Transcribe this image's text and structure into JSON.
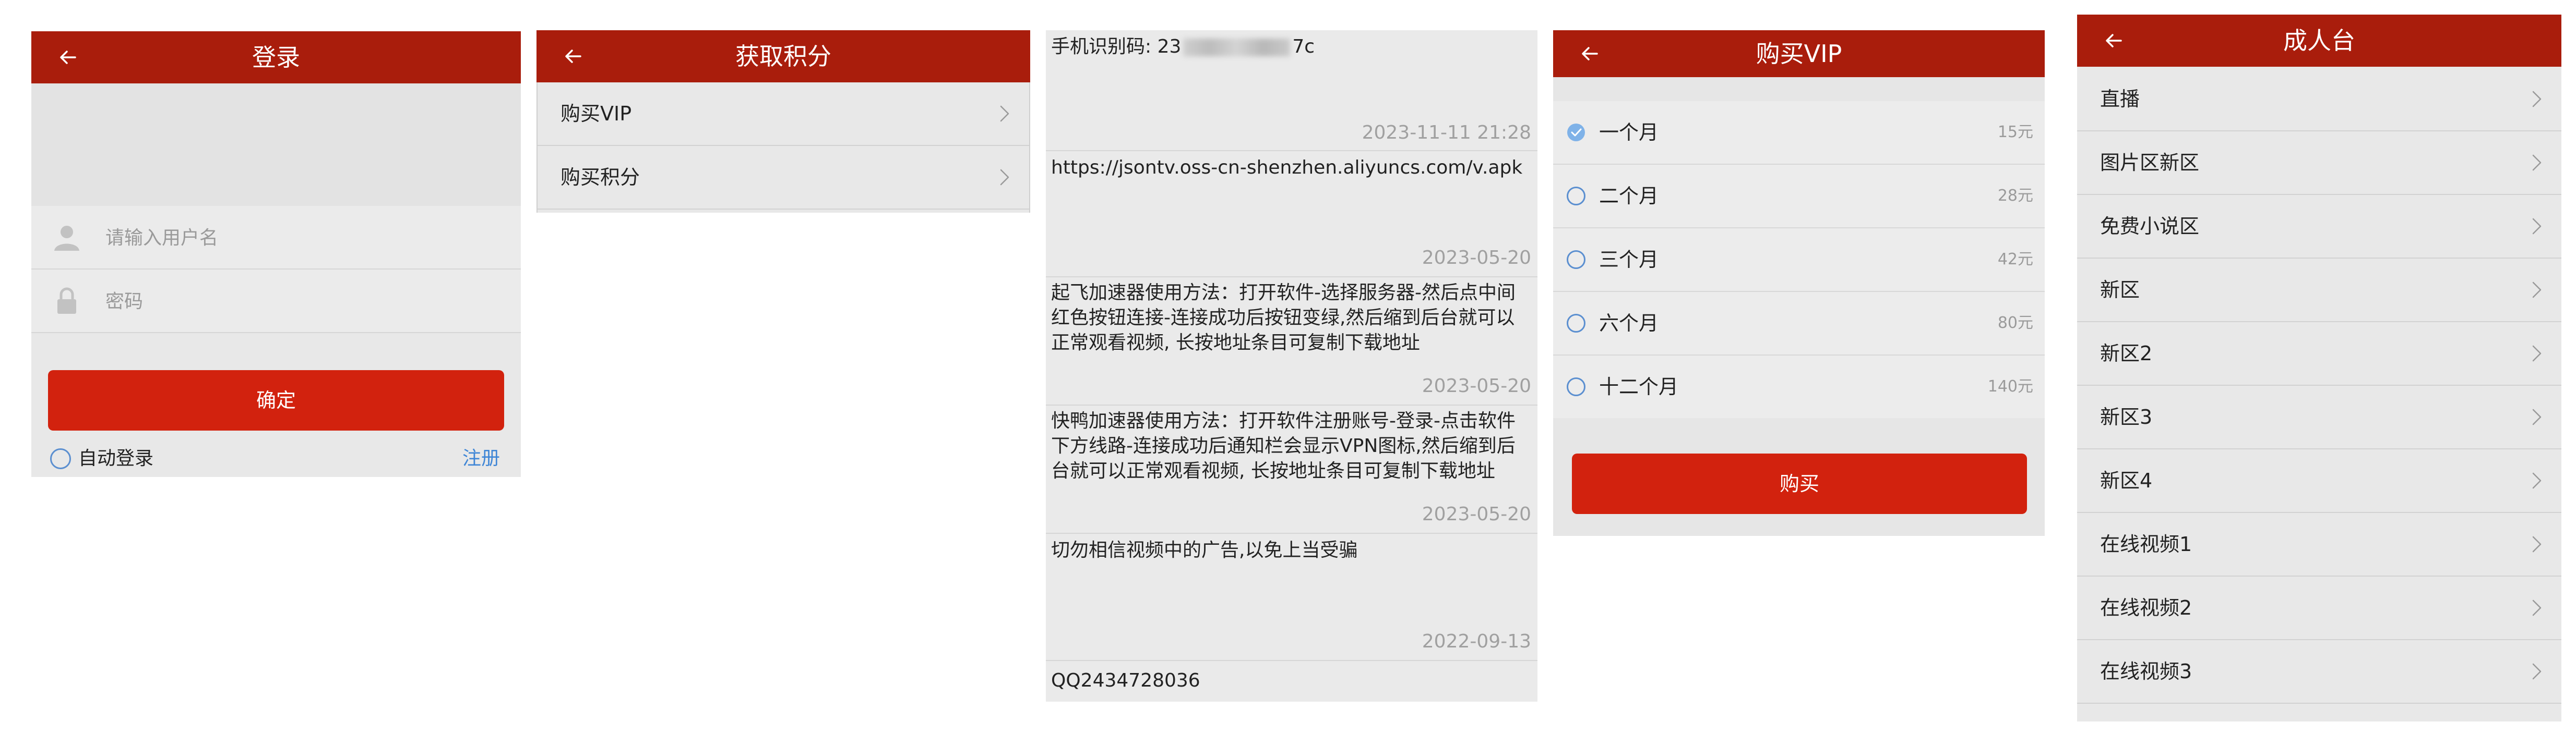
{
  "login": {
    "title": "登录",
    "username_placeholder": "请输入用户名",
    "password_placeholder": "密码",
    "confirm_label": "确定",
    "auto_login_label": "自动登录",
    "register_label": "注册"
  },
  "points": {
    "title": "获取积分",
    "items": [
      {
        "label": "购买VIP"
      },
      {
        "label": "购买积分"
      }
    ]
  },
  "messages": {
    "items": [
      {
        "text_prefix": "手机识别码: 23",
        "text_suffix": "7c",
        "date": "2023-11-11 21:28"
      },
      {
        "text": "https://jsontv.oss-cn-shenzhen.aliyuncs.com/v.apk",
        "date": "2023-05-20"
      },
      {
        "text": "起飞加速器使用方法：打开软件-选择服务器-然后点中间红色按钮连接-连接成功后按钮变绿,然后缩到后台就可以正常观看视频, 长按地址条目可复制下载地址",
        "date": "2023-05-20"
      },
      {
        "text": "快鸭加速器使用方法：打开软件注册账号-登录-点击软件下方线路-连接成功后通知栏会显示VPN图标,然后缩到后台就可以正常观看视频, 长按地址条目可复制下载地址",
        "date": "2023-05-20"
      },
      {
        "text": "切勿相信视频中的广告,以免上当受骗",
        "date": "2022-09-13"
      },
      {
        "text": "QQ2434728036"
      }
    ]
  },
  "vip": {
    "title": "购买VIP",
    "options": [
      {
        "label": "一个月",
        "price": "15元",
        "selected": true
      },
      {
        "label": "二个月",
        "price": "28元",
        "selected": false
      },
      {
        "label": "三个月",
        "price": "42元",
        "selected": false
      },
      {
        "label": "六个月",
        "price": "80元",
        "selected": false
      },
      {
        "label": "十二个月",
        "price": "140元",
        "selected": false
      }
    ],
    "buy_label": "购买"
  },
  "adult": {
    "title": "成人台",
    "items": [
      {
        "label": "直播"
      },
      {
        "label": "图片区新区"
      },
      {
        "label": "免费小说区"
      },
      {
        "label": "新区"
      },
      {
        "label": "新区2"
      },
      {
        "label": "新区3"
      },
      {
        "label": "新区4"
      },
      {
        "label": "在线视频1"
      },
      {
        "label": "在线视频2"
      },
      {
        "label": "在线视频3"
      }
    ]
  },
  "colors": {
    "header_red": "#a91d0c",
    "button_red": "#d2220e",
    "link_blue": "#3f86d6",
    "check_blue": "#5b8fd0"
  }
}
